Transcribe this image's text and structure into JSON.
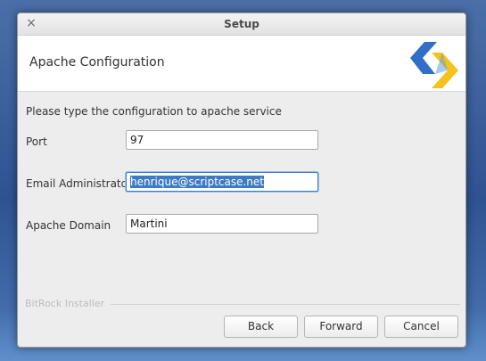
{
  "window": {
    "title": "Setup",
    "close_glyph": "×"
  },
  "header": {
    "title": "Apache Configuration",
    "logo_icon": "scriptcase-logo-icon"
  },
  "form": {
    "intro": "Please type the configuration to apache service",
    "fields": [
      {
        "label": "Port",
        "value": "97"
      },
      {
        "label": "Email Administrator",
        "value": "henrique@scriptcase.net"
      },
      {
        "label": "Apache Domain",
        "value": "Martini"
      }
    ]
  },
  "footer": {
    "brand": "BitRock Installer",
    "buttons": {
      "back": "Back",
      "forward": "Forward",
      "cancel": "Cancel"
    }
  },
  "colors": {
    "logo_blue": "#2f6fc6",
    "logo_yellow": "#f3c21b",
    "selection": "#3d7ac4"
  }
}
